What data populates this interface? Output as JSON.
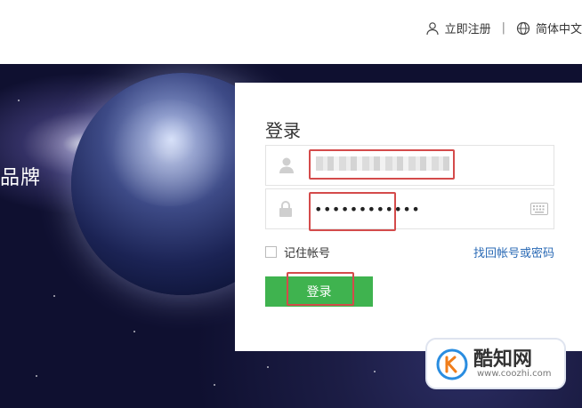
{
  "header": {
    "register_label": "立即注册",
    "language_label": "简体中文",
    "separator": "|"
  },
  "hero": {
    "partial_text": "品牌"
  },
  "login": {
    "title": "登录",
    "password_mask": "••••••••••••",
    "remember_label": "记住帐号",
    "forgot_label": "找回帐号或密码",
    "submit_label": "登录"
  },
  "watermark": {
    "name": "酷知网",
    "url": "www.coozhi.com"
  },
  "colors": {
    "accent_green": "#3fb34f",
    "link_blue": "#2a6ab5",
    "highlight_red": "#d44b4b"
  },
  "icons": [
    "user-icon",
    "globe-icon",
    "lock-icon",
    "keyboard-icon",
    "coozhi-logo-icon"
  ]
}
